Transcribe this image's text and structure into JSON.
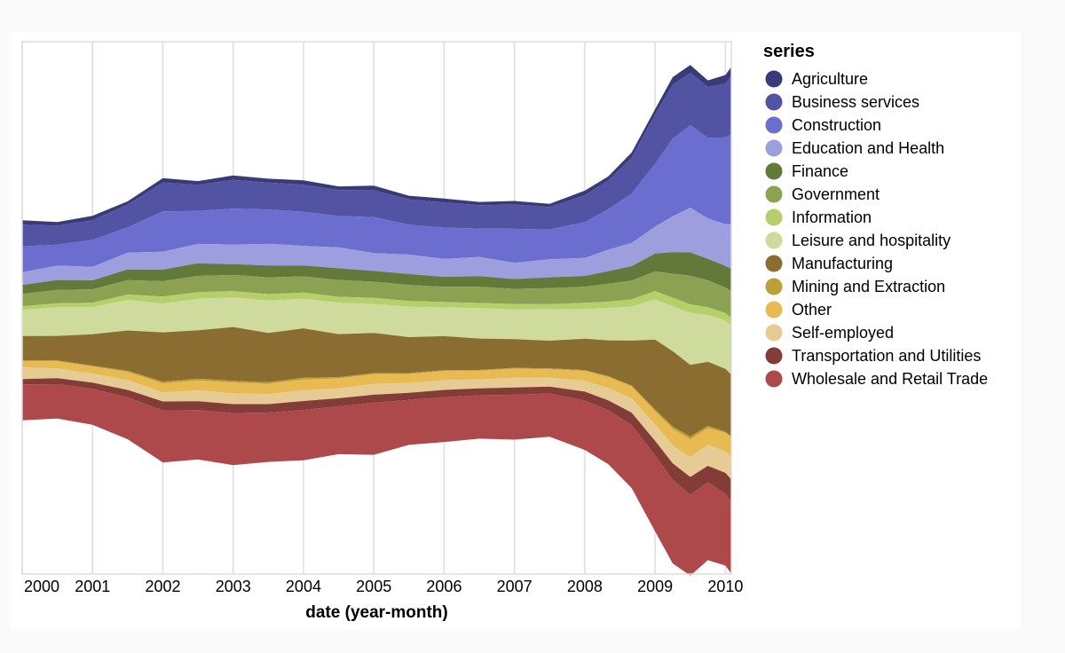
{
  "chart_data": {
    "type": "area",
    "subtype": "streamgraph",
    "stack_offset": "center",
    "title": "",
    "xlabel": "date (year-month)",
    "ylabel": "",
    "x_tick_labels": [
      "2000",
      "2001",
      "2002",
      "2003",
      "2004",
      "2005",
      "2006",
      "2007",
      "2008",
      "2009",
      "2010"
    ],
    "x_domain": [
      "2000-01",
      "2010-02"
    ],
    "grid": true,
    "legend": {
      "title": "series",
      "position": "right"
    },
    "x": [
      "2000-01",
      "2000-07",
      "2001-01",
      "2001-07",
      "2002-01",
      "2002-07",
      "2003-01",
      "2003-07",
      "2004-01",
      "2004-07",
      "2005-01",
      "2005-07",
      "2006-01",
      "2006-07",
      "2007-01",
      "2007-07",
      "2008-01",
      "2008-05",
      "2008-09",
      "2009-01",
      "2009-04",
      "2009-07",
      "2009-10",
      "2010-01",
      "2010-02"
    ],
    "series": [
      {
        "name": "Agriculture",
        "color": "#393b79",
        "values": [
          150,
          120,
          150,
          110,
          150,
          120,
          150,
          130,
          150,
          120,
          150,
          120,
          130,
          110,
          120,
          110,
          150,
          140,
          170,
          180,
          260,
          270,
          220,
          290,
          300
        ]
      },
      {
        "name": "Business services",
        "color": "#5254a3",
        "values": [
          720,
          640,
          660,
          760,
          960,
          880,
          960,
          900,
          900,
          870,
          900,
          850,
          840,
          780,
          810,
          750,
          900,
          960,
          1200,
          1650,
          1800,
          1750,
          1700,
          1800,
          1950
        ]
      },
      {
        "name": "Construction",
        "color": "#6b6ecf",
        "values": [
          870,
          700,
          900,
          850,
          1350,
          1100,
          1200,
          1150,
          1140,
          1050,
          1200,
          1000,
          1050,
          950,
          1140,
          1000,
          1200,
          1350,
          1650,
          2100,
          2600,
          2750,
          2700,
          2900,
          3000
        ]
      },
      {
        "name": "Education and Health",
        "color": "#9c9ede",
        "values": [
          420,
          480,
          450,
          560,
          600,
          650,
          660,
          720,
          660,
          700,
          600,
          650,
          600,
          640,
          540,
          600,
          600,
          720,
          780,
          900,
          1200,
          1500,
          1350,
          1400,
          1500
        ]
      },
      {
        "name": "Finance",
        "color": "#637939",
        "values": [
          300,
          330,
          300,
          360,
          390,
          420,
          360,
          400,
          360,
          390,
          360,
          360,
          330,
          360,
          330,
          360,
          360,
          420,
          480,
          600,
          720,
          780,
          720,
          720,
          750
        ]
      },
      {
        "name": "Government",
        "color": "#8ca252",
        "values": [
          420,
          450,
          450,
          480,
          510,
          540,
          540,
          560,
          540,
          560,
          540,
          540,
          510,
          540,
          510,
          540,
          540,
          600,
          630,
          660,
          800,
          960,
          900,
          850,
          900
        ]
      },
      {
        "name": "Information",
        "color": "#b5cf6b",
        "values": [
          120,
          130,
          150,
          180,
          240,
          230,
          210,
          220,
          210,
          200,
          210,
          190,
          180,
          170,
          180,
          170,
          210,
          210,
          240,
          270,
          290,
          280,
          260,
          250,
          240
        ]
      },
      {
        "name": "Leisure and hospitality",
        "color": "#cedb9c",
        "values": [
          870,
          960,
          900,
          1020,
          960,
          1050,
          990,
          1080,
          990,
          1050,
          960,
          1020,
          960,
          1020,
          990,
          1050,
          990,
          1080,
          1140,
          1350,
          1500,
          1740,
          1560,
          1620,
          1650
        ]
      },
      {
        "name": "Manufacturing",
        "color": "#8c6d31",
        "values": [
          810,
          820,
          1050,
          1350,
          1650,
          1620,
          1800,
          1650,
          1650,
          1440,
          1350,
          1200,
          1140,
          1050,
          960,
          930,
          1050,
          1200,
          1500,
          2340,
          2520,
          2400,
          2150,
          2100,
          2070
        ]
      },
      {
        "name": "Mining and Extraction",
        "color": "#bd9e39",
        "values": [
          30,
          25,
          30,
          40,
          60,
          60,
          60,
          50,
          60,
          45,
          30,
          30,
          30,
          25,
          30,
          25,
          30,
          30,
          40,
          60,
          80,
          90,
          70,
          40,
          30
        ]
      },
      {
        "name": "Other",
        "color": "#e7ba52",
        "values": [
          210,
          240,
          240,
          270,
          300,
          330,
          360,
          350,
          360,
          330,
          330,
          300,
          300,
          290,
          300,
          280,
          330,
          360,
          390,
          450,
          550,
          600,
          560,
          620,
          660
        ]
      },
      {
        "name": "Self-employed",
        "color": "#e7cb94",
        "values": [
          390,
          330,
          300,
          330,
          300,
          360,
          360,
          330,
          360,
          330,
          360,
          330,
          330,
          300,
          330,
          300,
          360,
          420,
          480,
          540,
          600,
          660,
          700,
          720,
          750
        ]
      },
      {
        "name": "Transportation and Utilities",
        "color": "#843c39",
        "values": [
          180,
          200,
          210,
          250,
          300,
          300,
          300,
          280,
          300,
          270,
          270,
          240,
          240,
          230,
          240,
          230,
          300,
          330,
          420,
          480,
          550,
          600,
          560,
          700,
          750
        ]
      },
      {
        "name": "Wholesale and Retail Trade",
        "color": "#ad494a",
        "values": [
          1200,
          1150,
          1200,
          1400,
          1740,
          1650,
          1740,
          1650,
          1680,
          1600,
          1740,
          1500,
          1500,
          1450,
          1500,
          1450,
          1650,
          1800,
          2100,
          2550,
          2800,
          2700,
          2600,
          2400,
          2400
        ]
      }
    ]
  }
}
